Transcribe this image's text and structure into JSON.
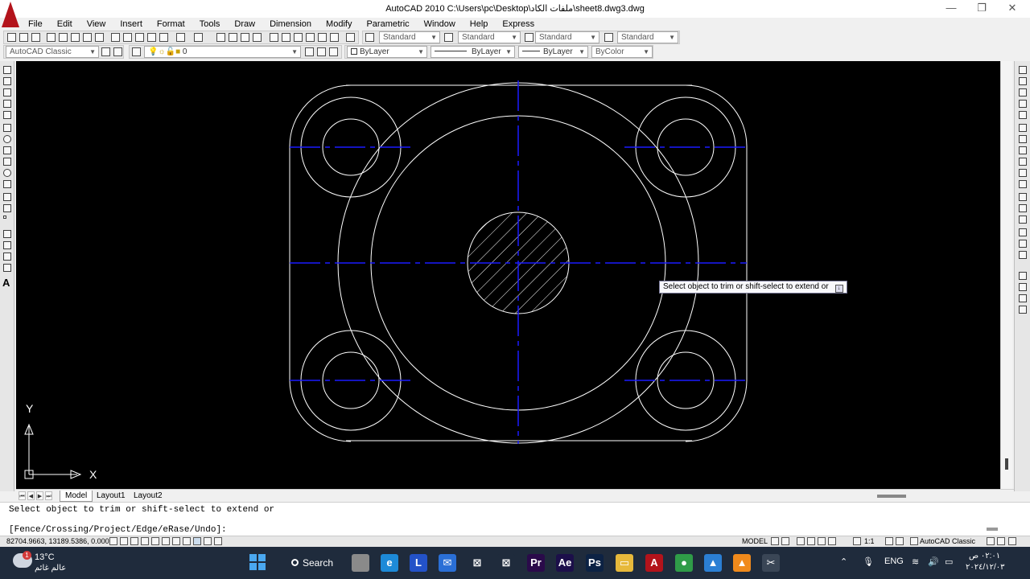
{
  "window": {
    "title": "AutoCAD 2010      C:\\Users\\pc\\Desktop\\ملفات الكاد\\sheet8.dwg3.dwg",
    "minimize": "—",
    "maximize": "❐",
    "close": "✕"
  },
  "menu": [
    "File",
    "Edit",
    "View",
    "Insert",
    "Format",
    "Tools",
    "Draw",
    "Dimension",
    "Modify",
    "Parametric",
    "Window",
    "Help",
    "Express"
  ],
  "styles": {
    "text_style": "Standard",
    "dim_style": "Standard",
    "table_style": "Standard",
    "multileader_style": "Standard"
  },
  "properties": {
    "workspace": "AutoCAD Classic",
    "layer": "0",
    "color": "ByLayer",
    "linetype": "ByLayer",
    "lineweight": "ByLayer",
    "plot_style": "ByColor"
  },
  "ucs": {
    "y_label": "Y",
    "x_label": "X"
  },
  "tooltip": {
    "text": "Select object to trim or shift-select to extend or",
    "button": "↓"
  },
  "tabs": {
    "nav": [
      "⏮",
      "◀",
      "▶",
      "⏭"
    ],
    "items": [
      "Model",
      "Layout1",
      "Layout2"
    ]
  },
  "command": {
    "history": "Select object to trim or shift-select to extend or",
    "prompt": "[Fence/Crossing/Project/Edge/eRase/Undo]:"
  },
  "status": {
    "coords": "82704.9663, 13189.5386, 0.0000",
    "model": "MODEL",
    "scale": "1:1",
    "workspace": "AutoCAD Classic"
  },
  "taskbar": {
    "weather_temp": "13°C",
    "weather_desc": "عالم غائم",
    "weather_badge": "1",
    "search": "Search",
    "apps": [
      {
        "name": "file-explorer-app",
        "label": "",
        "color": "#8a8a8a"
      },
      {
        "name": "edge-app",
        "label": "e",
        "color": "#1d8ad8"
      },
      {
        "name": "l-app",
        "label": "L",
        "color": "#2352c8"
      },
      {
        "name": "mail-app",
        "label": "✉",
        "color": "#2a6fd6"
      },
      {
        "name": "capcut-app-1",
        "label": "⊠",
        "color": "#1f2b3c"
      },
      {
        "name": "capcut-app-2",
        "label": "⊠",
        "color": "#1f2b3c"
      },
      {
        "name": "premiere-app",
        "label": "Pr",
        "color": "#2a0a4a"
      },
      {
        "name": "after-effects-app",
        "label": "Ae",
        "color": "#1c0f4a"
      },
      {
        "name": "photoshop-app",
        "label": "Ps",
        "color": "#0c2244"
      },
      {
        "name": "folder-app",
        "label": "▭",
        "color": "#e7b93b"
      },
      {
        "name": "autocad-app",
        "label": "A",
        "color": "#b3131b"
      },
      {
        "name": "chrome-app",
        "label": "●",
        "color": "#2f9c48"
      },
      {
        "name": "photos-app",
        "label": "▲",
        "color": "#2b7fd4"
      },
      {
        "name": "vlc-app",
        "label": "▲",
        "color": "#f08a1c"
      },
      {
        "name": "snipping-app",
        "label": "✂",
        "color": "#3a4656"
      }
    ],
    "tray_chevron": "⌃",
    "lang": "ENG",
    "time": "٠٢:٠١ ص",
    "date": "٢٠٢٤/١٢/٠٣"
  },
  "colors": {
    "canvas": "#000000",
    "geometry": "#ffffff",
    "centerline": "#1a1aff",
    "taskbar": "#1f2b3c"
  }
}
